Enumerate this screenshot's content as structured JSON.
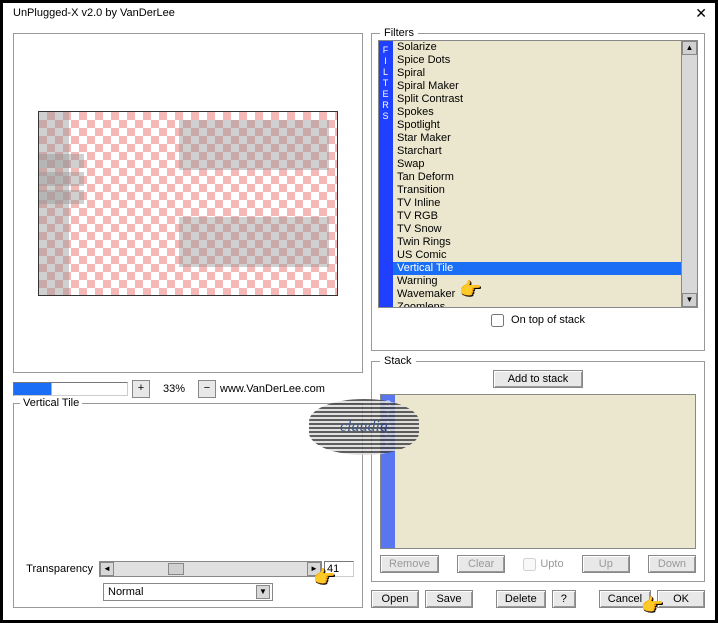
{
  "window": {
    "title": "UnPlugged-X v2.0 by VanDerLee",
    "close": "✕"
  },
  "zoom": {
    "plus": "+",
    "minus": "−",
    "percent": "33%",
    "url": "www.VanDerLee.com"
  },
  "settings": {
    "group_label": "Vertical Tile",
    "transparency_label": "Transparency",
    "transparency_value": "41",
    "mode": "Normal"
  },
  "filters": {
    "legend": "Filters",
    "tab": "FILTERS",
    "on_top": "On top of stack",
    "items": [
      "Solarize",
      "Spice Dots",
      "Spiral",
      "Spiral Maker",
      "Split Contrast",
      "Spokes",
      "Spotlight",
      "Star Maker",
      "Starchart",
      "Swap",
      "Tan Deform",
      "Transition",
      "TV Inline",
      "TV RGB",
      "TV Snow",
      "Twin Rings",
      "US Comic",
      "Vertical Tile",
      "Warning",
      "Wavemaker",
      "Zoomlens"
    ],
    "selected_index": 17
  },
  "stack": {
    "legend": "Stack",
    "add": "Add to stack",
    "tab": "STACK",
    "buttons": {
      "remove": "Remove",
      "clear": "Clear",
      "upto": "Upto",
      "up": "Up",
      "down": "Down"
    }
  },
  "buttons": {
    "open": "Open",
    "save": "Save",
    "delete": "Delete",
    "help": "?",
    "cancel": "Cancel",
    "ok": "OK"
  },
  "watermark": "claudia"
}
